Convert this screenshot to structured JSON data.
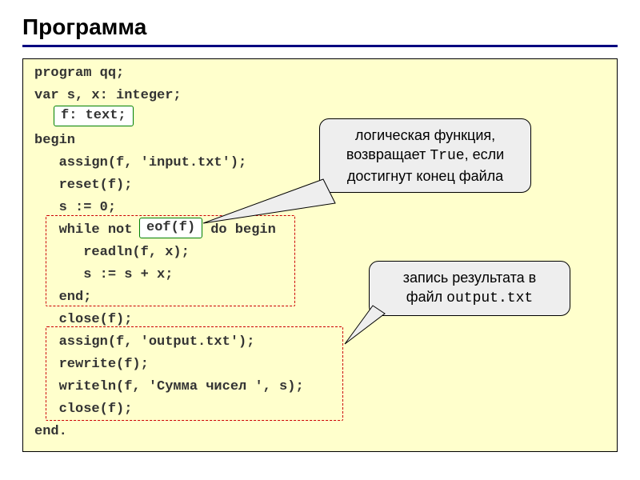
{
  "title": "Программа",
  "code": {
    "l1": "program qq;",
    "l2": "var s, x: integer;",
    "ftext_box": "f: text;",
    "l3": "begin",
    "l4": "   assign(f, 'input.txt');",
    "l5": "   reset(f);",
    "l6": "   s := 0;",
    "l7a": "   while not ",
    "eof_box": "eof(f)",
    "l7b": " do begin",
    "l8": "      readln(f, x);",
    "l9": "      s := s + x;",
    "l10": "   end;",
    "l11": "   close(f);",
    "l12": "   assign(f, 'output.txt');",
    "l13": "   rewrite(f);",
    "l14": "   writeln(f, 'Сумма чисел ', s);",
    "l15": "   close(f);",
    "l16": "end."
  },
  "callout1": {
    "line1": "логическая функция,",
    "line2_a": "возвращает ",
    "line2_b": "True",
    "line2_c": ", если",
    "line3": "достигнут конец файла"
  },
  "callout2": {
    "line1": "запись результата в",
    "line2_a": "файл ",
    "line2_b": "output.txt"
  }
}
